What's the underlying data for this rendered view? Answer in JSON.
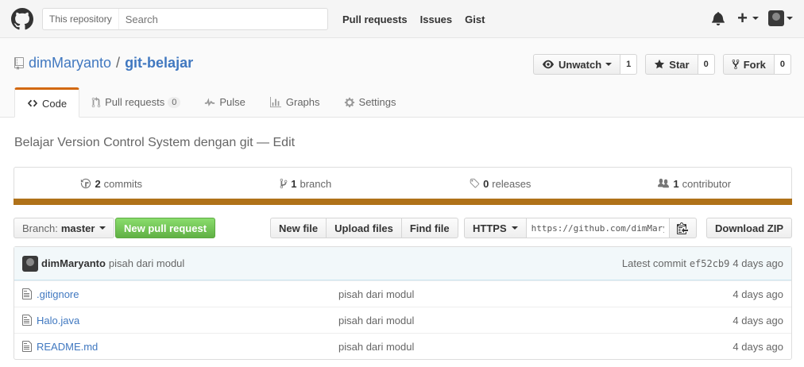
{
  "header": {
    "search_scope": "This repository",
    "search_placeholder": "Search",
    "nav": [
      "Pull requests",
      "Issues",
      "Gist"
    ]
  },
  "repo": {
    "owner": "dimMaryanto",
    "separator": "/",
    "name": "git-belajar",
    "description": "Belajar Version Control System dengan git — Edit"
  },
  "actions": {
    "watch_label": "Unwatch",
    "watch_count": "1",
    "star_label": "Star",
    "star_count": "0",
    "fork_label": "Fork",
    "fork_count": "0"
  },
  "tabs": {
    "code": "Code",
    "pull_requests": "Pull requests",
    "pull_requests_count": "0",
    "pulse": "Pulse",
    "graphs": "Graphs",
    "settings": "Settings"
  },
  "summary": {
    "commits_count": "2",
    "commits_label": "commits",
    "branch_count": "1",
    "branch_label": "branch",
    "releases_count": "0",
    "releases_label": "releases",
    "contributor_count": "1",
    "contributor_label": "contributor"
  },
  "language_color": "#b07219",
  "filebar": {
    "branch_prefix": "Branch:",
    "branch_name": "master",
    "new_pr": "New pull request",
    "new_file": "New file",
    "upload_files": "Upload files",
    "find_file": "Find file",
    "protocol": "HTTPS",
    "clone_url": "https://github.com/dimMaryanto/git-belajar.git",
    "download_zip": "Download ZIP"
  },
  "latest_commit": {
    "author": "dimMaryanto",
    "message": "pisah dari modul",
    "label": "Latest commit",
    "sha": "ef52cb9",
    "age": "4 days ago"
  },
  "files": [
    {
      "name": ".gitignore",
      "message": "pisah dari modul",
      "age": "4 days ago"
    },
    {
      "name": "Halo.java",
      "message": "pisah dari modul",
      "age": "4 days ago"
    },
    {
      "name": "README.md",
      "message": "pisah dari modul",
      "age": "4 days ago"
    }
  ]
}
